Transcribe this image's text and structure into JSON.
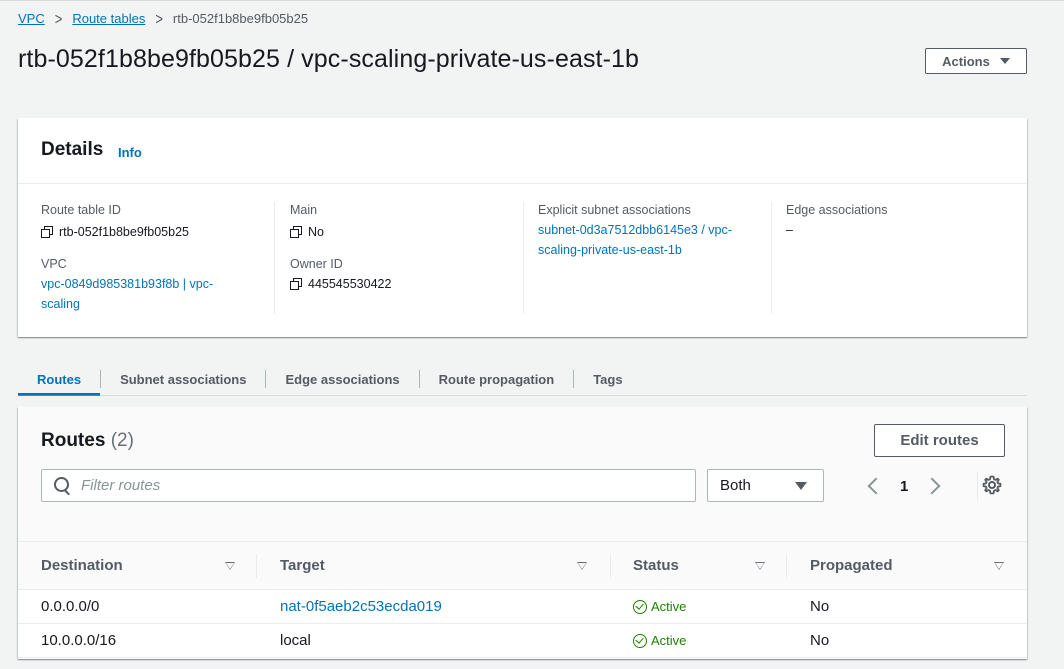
{
  "breadcrumb": {
    "items": [
      "VPC",
      "Route tables"
    ],
    "current": "rtb-052f1b8be9fb05b25",
    "separator": ">"
  },
  "page": {
    "title": "rtb-052f1b8be9fb05b25 / vpc-scaling-private-us-east-1b",
    "actions_label": "Actions"
  },
  "details": {
    "title": "Details",
    "info_label": "Info",
    "route_table_id_label": "Route table ID",
    "route_table_id_value": "rtb-052f1b8be9fb05b25",
    "vpc_label": "VPC",
    "vpc_value_line1": "vpc-0849d985381b93f8b | vpc-",
    "vpc_value_line2": "scaling",
    "main_label": "Main",
    "main_value": "No",
    "owner_label": "Owner ID",
    "owner_value": "445545530422",
    "explicit_label": "Explicit subnet associations",
    "explicit_value_line1": "subnet-0d3a7512dbb6145e3 / vpc-",
    "explicit_value_line2": "scaling-private-us-east-1b",
    "edge_label": "Edge associations",
    "edge_value": "–"
  },
  "tabs": [
    "Routes",
    "Subnet associations",
    "Edge associations",
    "Route propagation",
    "Tags"
  ],
  "routes": {
    "title": "Routes",
    "count": "(2)",
    "edit_label": "Edit routes",
    "filter_placeholder": "Filter routes",
    "select_value": "Both",
    "page_number": "1",
    "columns": [
      "Destination",
      "Target",
      "Status",
      "Propagated"
    ],
    "rows": [
      {
        "destination": "0.0.0.0/0",
        "target": "nat-0f5aeb2c53ecda019",
        "target_is_link": true,
        "status": "Active",
        "propagated": "No"
      },
      {
        "destination": "10.0.0.0/16",
        "target": "local",
        "target_is_link": false,
        "status": "Active",
        "propagated": "No"
      }
    ]
  },
  "colors": {
    "link": "#0073bb",
    "success": "#1d8102",
    "text": "#16191f",
    "secondary": "#545b64"
  }
}
